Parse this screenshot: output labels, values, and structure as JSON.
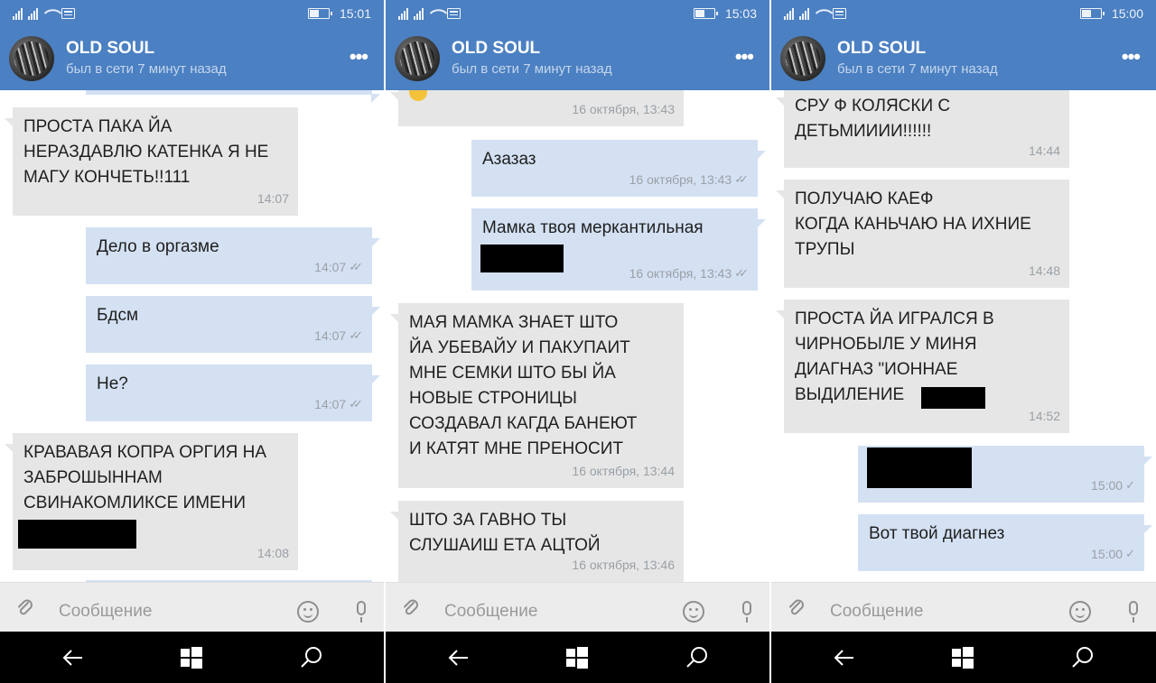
{
  "colors": {
    "header": "#4b80c2",
    "incoming": "#e6e6e6",
    "outgoing": "#d4e1f3",
    "navbar": "#000000"
  },
  "contact": {
    "name": "OLD SOUL",
    "status": "был в сети 7 минут назад"
  },
  "input": {
    "placeholder": "Сообщение"
  },
  "icons": [
    "signal-icon",
    "wifi-icon",
    "message-icon",
    "battery-icon",
    "menu-dots-icon",
    "paperclip-icon",
    "smile-icon",
    "mic-icon",
    "back-icon",
    "windows-icon",
    "search-icon"
  ],
  "panels": [
    {
      "time": "15:01",
      "messages": [
        {
          "dir": "in",
          "text": "ПРОСТА ПАКА ЙА\nНЕРАЗДАВЛЮ КАТЕНКА Я НЕ\nМАГУ КОНЧЕТЬ!!111",
          "time": "14:07"
        },
        {
          "dir": "out",
          "text": "Дело в оргазме",
          "time": "14:07"
        },
        {
          "dir": "out",
          "text": "Бдсм",
          "time": "14:07"
        },
        {
          "dir": "out",
          "text": "Не?",
          "time": "14:07"
        },
        {
          "dir": "in",
          "text": "КРАВАВАЯ КОПРА ОРГИЯ НА\nЗАБРОШЫННАМ\nСВИНАКОМЛИКСЕ ИМЕНИ",
          "time": "14:08"
        }
      ]
    },
    {
      "time": "15:03",
      "messages": [
        {
          "dir": "in",
          "text": "",
          "time": "16 октября, 13:43"
        },
        {
          "dir": "out",
          "text": "Азазаз",
          "time": "16 октября, 13:43"
        },
        {
          "dir": "out",
          "text": "Мамка твоя меркантильная",
          "time": "16 октября, 13:43"
        },
        {
          "dir": "in",
          "text": "МАЯ МАМКА ЗНАЕТ ШТО\nЙА УБЕВАЙУ И ПАКУПАИТ\nМНЕ СЕМКИ ШТО БЫ ЙА\nНОВЫЕ СТРОНИЦЫ\nСОЗДАВАЛ КАГДА БАНЕЮТ\nИ КАТЯТ МНЕ ПРЕНОСИТ",
          "time": "16 октября, 13:44"
        },
        {
          "dir": "in",
          "text": "ШТО ЗА ГАВНО ТЫ\nСЛУШАИШ ЕТА АЦТОЙ",
          "time": "16 октября, 13:46"
        }
      ]
    },
    {
      "time": "15:00",
      "messages": [
        {
          "dir": "in",
          "text": "СРУ Ф КОЛЯСКИ С\nДЕТЬМИИИИ!!!!!!",
          "time": "14:44"
        },
        {
          "dir": "in",
          "text": "ПОЛУЧАЮ КАЕФ\nКОГДА КАНЬЧАЮ НА ИХНИЕ\nТРУПЫ",
          "time": "14:48"
        },
        {
          "dir": "in",
          "text": "ПРОСТА ЙА ИГРАЛСЯ В\nЧИРНОБЫЛЕ У МИНЯ\nДИАГНАЗ \"ИОННАЕ\nВЫДИЛЕНИЕ",
          "time": "14:52"
        },
        {
          "dir": "out",
          "text": "",
          "time": "15:00"
        },
        {
          "dir": "out",
          "text": "Вот твой диагнез",
          "time": "15:00"
        }
      ]
    }
  ]
}
